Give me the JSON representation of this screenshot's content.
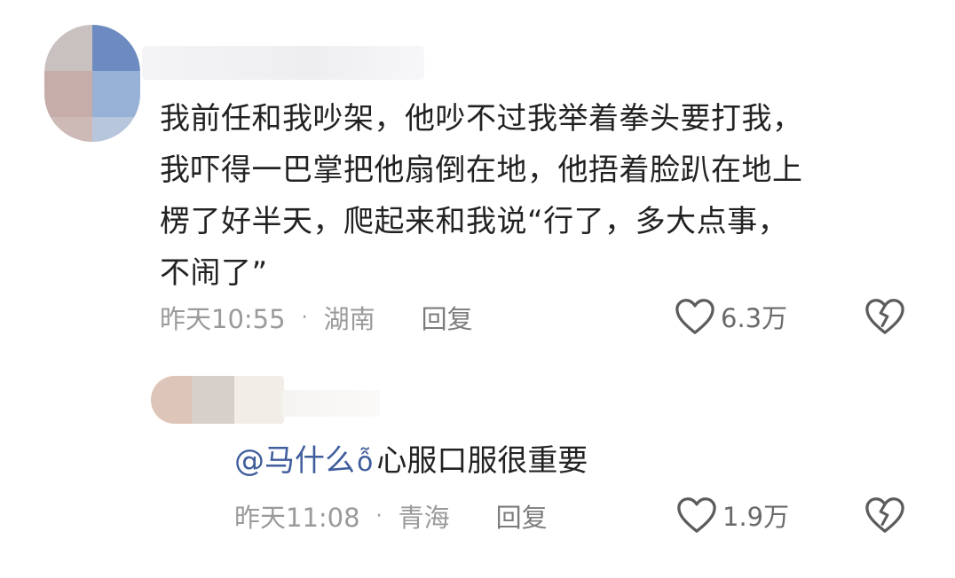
{
  "comment": {
    "lines": [
      "我前任和我吵架，他吵不过我举着拳头要打我，",
      "我吓得一巴掌把他扇倒在地，他捂着脸趴在地上",
      "楞了好半天，爬起来和我说“行了，多大点事，",
      "不闹了”"
    ],
    "time": "昨天10:55",
    "separator": "·",
    "location": "湖南",
    "reply_label": "回复",
    "likes": "6.3万"
  },
  "reply": {
    "mention": "@马什么",
    "mention_emoji": "ỗ",
    "text": "心服口服很重要",
    "time": "昨天11:08",
    "separator": "·",
    "location": "青海",
    "reply_label": "回复",
    "likes": "1.9万"
  },
  "icons": {
    "like": "heart-outline-icon",
    "dislike": "broken-heart-icon"
  }
}
